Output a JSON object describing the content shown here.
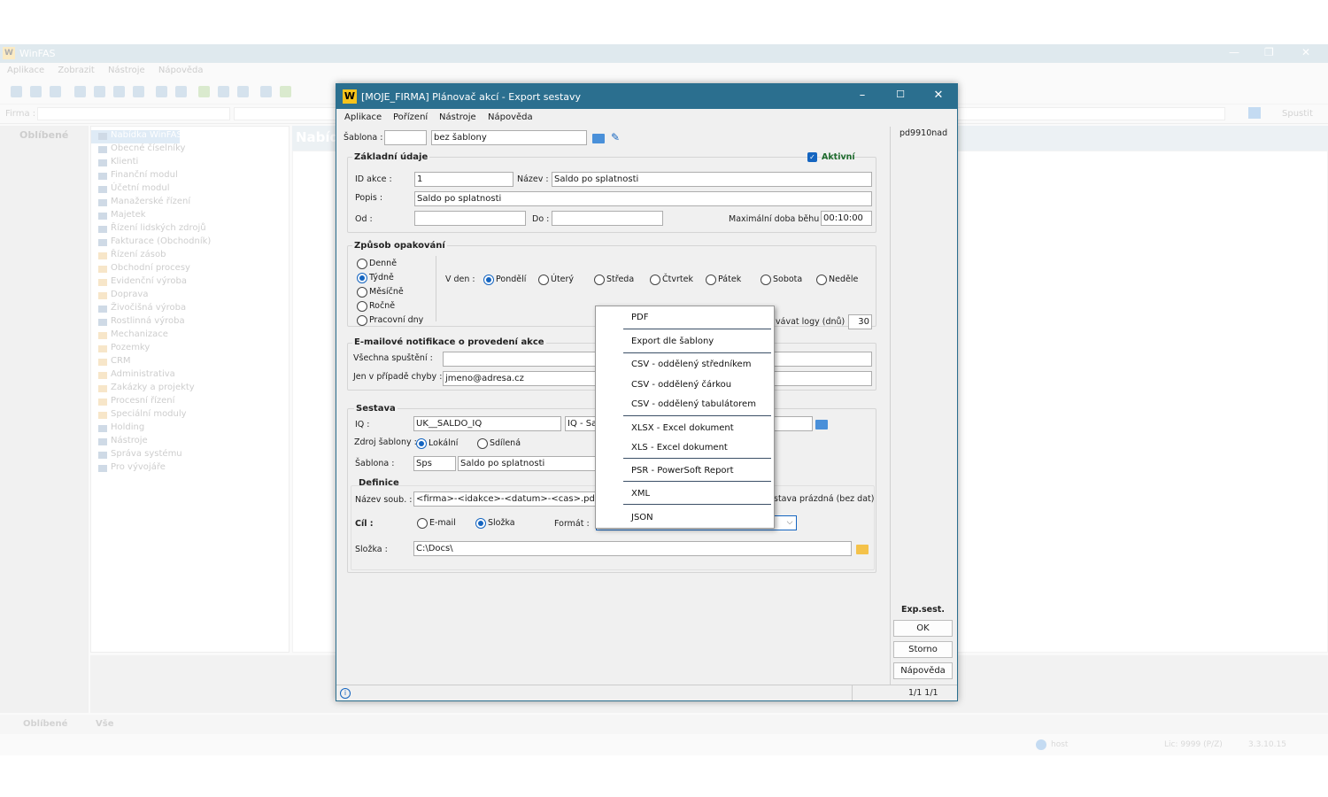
{
  "bg": {
    "title": "WinFAS",
    "menu": [
      "Aplikace",
      "Zobrazit",
      "Nástroje",
      "Nápověda"
    ],
    "firma_label": "Firma :",
    "run_label": "Spustit",
    "left_title": "Oblíbené",
    "main_tab": "Nabídka",
    "tree": [
      "Nabídka WinFAS",
      "Obecné číselníky",
      "Klienti",
      "Finanční modul",
      "Účetní modul",
      "Manažerské řízení",
      "Majetek",
      "Řízení lidských zdrojů",
      "Fakturace (Obchodník)",
      "Řízení zásob",
      "Obchodní procesy",
      "Evidenční výroba",
      "Doprava",
      "Živočišná výroba",
      "Rostlinná výroba",
      "Mechanizace",
      "Pozemky",
      "CRM",
      "Administrativa",
      "Zakázky a projekty",
      "Procesní řízení",
      "Speciální moduly",
      "Holding",
      "Nástroje",
      "Správa systému",
      "Pro vývojáře"
    ],
    "tab_fav": "Oblíbené",
    "tab_all": "Vše",
    "status_user": "host",
    "status_lic": "Lic: 9999 (P/Z)",
    "status_ver": "3.3.10.15"
  },
  "dialog": {
    "title": "[MOJE_FIRMA] Plánovač akcí - Export sestavy",
    "menu": [
      "Aplikace",
      "Pořízení",
      "Nástroje",
      "Nápověda"
    ],
    "code": "pd9910nad",
    "sablona_label": "Šablona :",
    "sablona_code": "",
    "sablona_value": "bez šablony",
    "zakladni": {
      "title": "Základní údaje",
      "aktivni_label": "Aktivní",
      "id_label": "ID akce :",
      "id_value": "1",
      "nazev_label": "Název :",
      "nazev_value": "Saldo po splatnosti",
      "popis_label": "Popis :",
      "popis_value": "Saldo po splatnosti",
      "od_label": "Od :",
      "do_label": "Do :",
      "maxdoba_label": "Maximální doba běhu :",
      "maxdoba_value": "00:10:00"
    },
    "opakovani": {
      "title": "Způsob opakování",
      "options": [
        "Denně",
        "Týdně",
        "Měsíčně",
        "Ročně",
        "Pracovní dny"
      ],
      "vden_label": "V den :",
      "days": [
        "Pondělí",
        "Úterý",
        "Středa",
        "Čtvrtek",
        "Pátek",
        "Sobota",
        "Neděle"
      ],
      "logy_label": "vávat logy (dnů) :",
      "logy_value": "30"
    },
    "email": {
      "title": "E-mailové notifikace o provedení akce",
      "vsechna_label": "Všechna spuštění :",
      "chyba_label": "Jen v případě chyby :",
      "chyba_value": "jmeno@adresa.cz"
    },
    "sestava": {
      "title": "Sestava",
      "iq_label": "IQ :",
      "iq_value": "UK__SALDO_IQ",
      "iq_name": "IQ - Sa",
      "zdroj_label": "Zdroj šablony :",
      "zdroj_options": [
        "Lokální",
        "Sdílená"
      ],
      "sablona_label": "Šablona :",
      "sablona_code": "Sps",
      "sablona_name": "Saldo po splatnosti"
    },
    "definice": {
      "title": "Definice",
      "nazevsoub_label": "Název soub. :",
      "nazevsoub_value": "<firma>-<idakce>-<datum>-<cas>.pdf",
      "prazdna_label": "stava prázdná (bez dat)",
      "cil_label": "Cíl :",
      "cil_options": [
        "E-mail",
        "Složka"
      ],
      "format_label": "Formát :",
      "slozka_label": "Složka :",
      "slozka_value": "C:\\Docs\\"
    },
    "side_title": "Exp.sest.",
    "ok": "OK",
    "storno": "Storno",
    "napoveda": "Nápověda",
    "paging": "1/1  1/1"
  },
  "dropdown": [
    "PDF",
    "Export dle šablony",
    "CSV - oddělený středníkem",
    "CSV - oddělený čárkou",
    "CSV - oddělený tabulátorem",
    "XLSX - Excel dokument",
    "XLS - Excel dokument",
    "PSR - PowerSoft Report",
    "XML",
    "JSON"
  ]
}
